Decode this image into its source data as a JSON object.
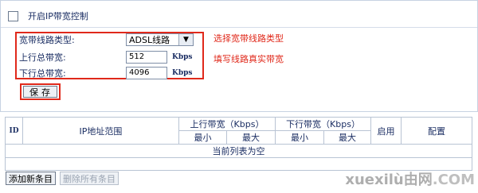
{
  "enable": {
    "label": "开启IP带宽控制",
    "checked": false
  },
  "settings": {
    "line_type_label": "宽带线路类型:",
    "line_type_value": "ADSL线路",
    "up_label": "上行总带宽:",
    "up_value": "512",
    "up_unit": "Kbps",
    "down_label": "下行总带宽:",
    "down_value": "4096",
    "down_unit": "Kbps",
    "hint_line_type": "选择宽带线路类型",
    "hint_fill": "填写线路真实带宽",
    "save_label": "保存"
  },
  "table": {
    "col_id": "ID",
    "col_ip": "IP地址范围",
    "col_up": "上行带宽（Kbps）",
    "col_down": "下行带宽（Kbps）",
    "col_enable": "启用",
    "col_config": "配置",
    "sub_min": "最小",
    "sub_max": "最大",
    "empty_text": "当前列表为空"
  },
  "buttons": {
    "add": "添加新条目",
    "delete_all": "删除所有条目"
  },
  "watermark": {
    "text": "xuexilù由网",
    "suffix": ".COM"
  }
}
